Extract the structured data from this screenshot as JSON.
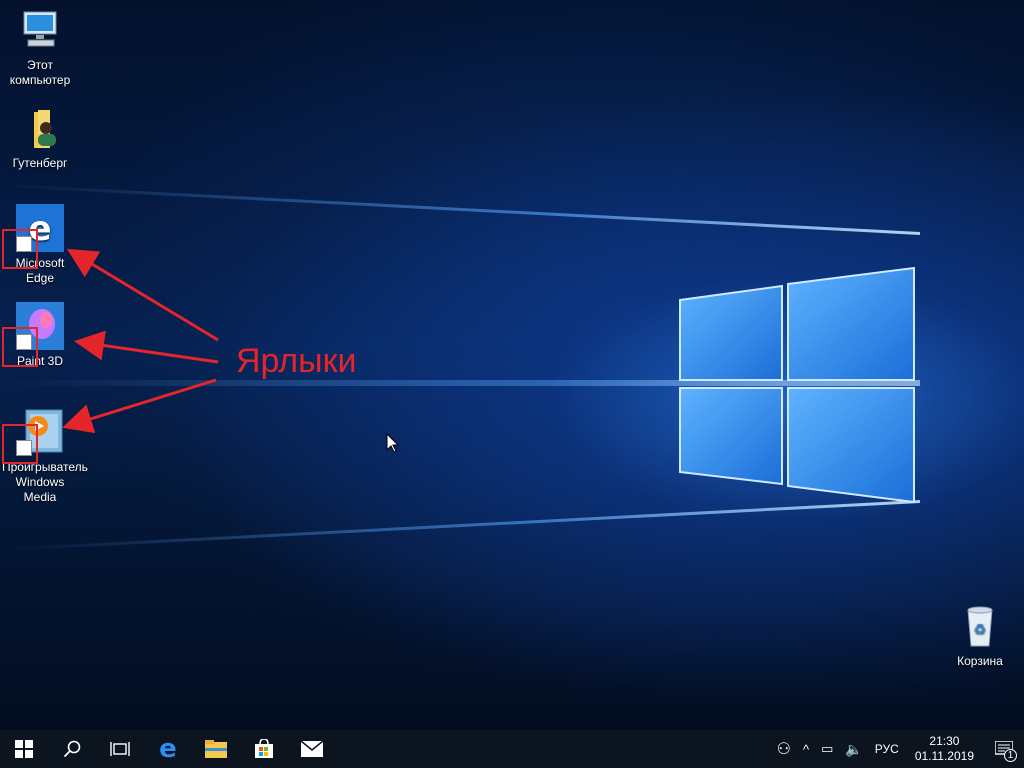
{
  "desktop_icons": [
    {
      "label": "Этот компьютер",
      "icon": "this-pc-icon"
    },
    {
      "label": "Гутенберг",
      "icon": "user-folder-icon"
    },
    {
      "label": "Microsoft Edge",
      "icon": "edge-icon",
      "shortcut": true
    },
    {
      "label": "Paint 3D",
      "icon": "paint3d-icon",
      "shortcut": true
    },
    {
      "label": "Проигрыватель Windows Media",
      "icon": "windows-media-player-icon",
      "shortcut": true
    }
  ],
  "recycle_bin": {
    "label": "Корзина",
    "icon": "recycle-bin-icon"
  },
  "annotation": {
    "text": "Ярлыки",
    "color": "#e4252a"
  },
  "taskbar": {
    "items": [
      "start-icon",
      "search-icon",
      "task-view-icon",
      "edge-icon",
      "file-explorer-icon",
      "store-icon",
      "mail-icon"
    ],
    "tray": {
      "language": "РУС",
      "time": "21:30",
      "date": "01.11.2019",
      "notifications_count": "1"
    }
  }
}
